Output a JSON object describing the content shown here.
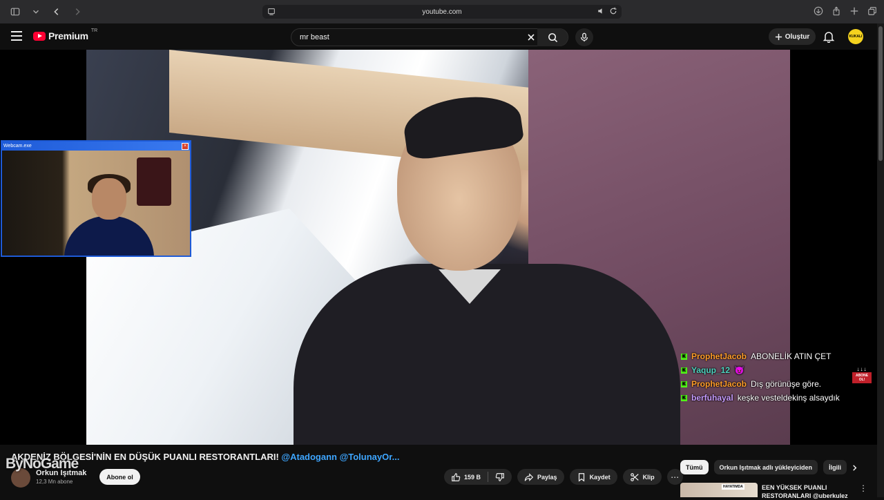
{
  "browser": {
    "url": "youtube.com"
  },
  "header": {
    "logo_text": "Premium",
    "country_code": "TR",
    "search_value": "mr beast",
    "create_label": "Oluştur",
    "avatar_text": "KUKALI"
  },
  "webcam": {
    "title": "Webcam.exe",
    "close": "×"
  },
  "chat": [
    {
      "user": "ProphetJacob",
      "message": "ABONELİK ATIN ÇET",
      "color": "#ff9d2a"
    },
    {
      "user": "Yaqup_12",
      "message": "😈",
      "color": "#4fd4c0"
    },
    {
      "user": "ProphetJacob",
      "message": "Dış görünüşe göre.",
      "color": "#ff9d2a"
    },
    {
      "user": "berfuhayal",
      "message": "keşke vesteldekinş alsaydık",
      "color": "#c79cff"
    }
  ],
  "chat_badge": {
    "arrows": "↓↓↓",
    "line1": "ABONE",
    "line2": "OL!"
  },
  "video": {
    "title_main": "AKDENİZ BÖLGESİ'NİN EN DÜŞÜK PUANLI RESTORANTLARI! ",
    "title_mentions": "@Atadogann @TolunayOr...",
    "watermark": "ByNoGame",
    "channel_name": "Orkun Işıtmak",
    "subscribers": "12,3 Mn abone",
    "subscribe_label": "Abone ol",
    "likes": "159 B",
    "share_label": "Paylaş",
    "save_label": "Kaydet",
    "clip_label": "Klip"
  },
  "sidebar": {
    "chips": [
      "Tümü",
      "Orkun Işıtmak adlı yükleyiciden",
      "İlgili"
    ],
    "rec_title": "EEN YÜKSEK PUANLI RESTORANLARI @uberkulez",
    "rec_badge": "HAYATIMDA"
  }
}
